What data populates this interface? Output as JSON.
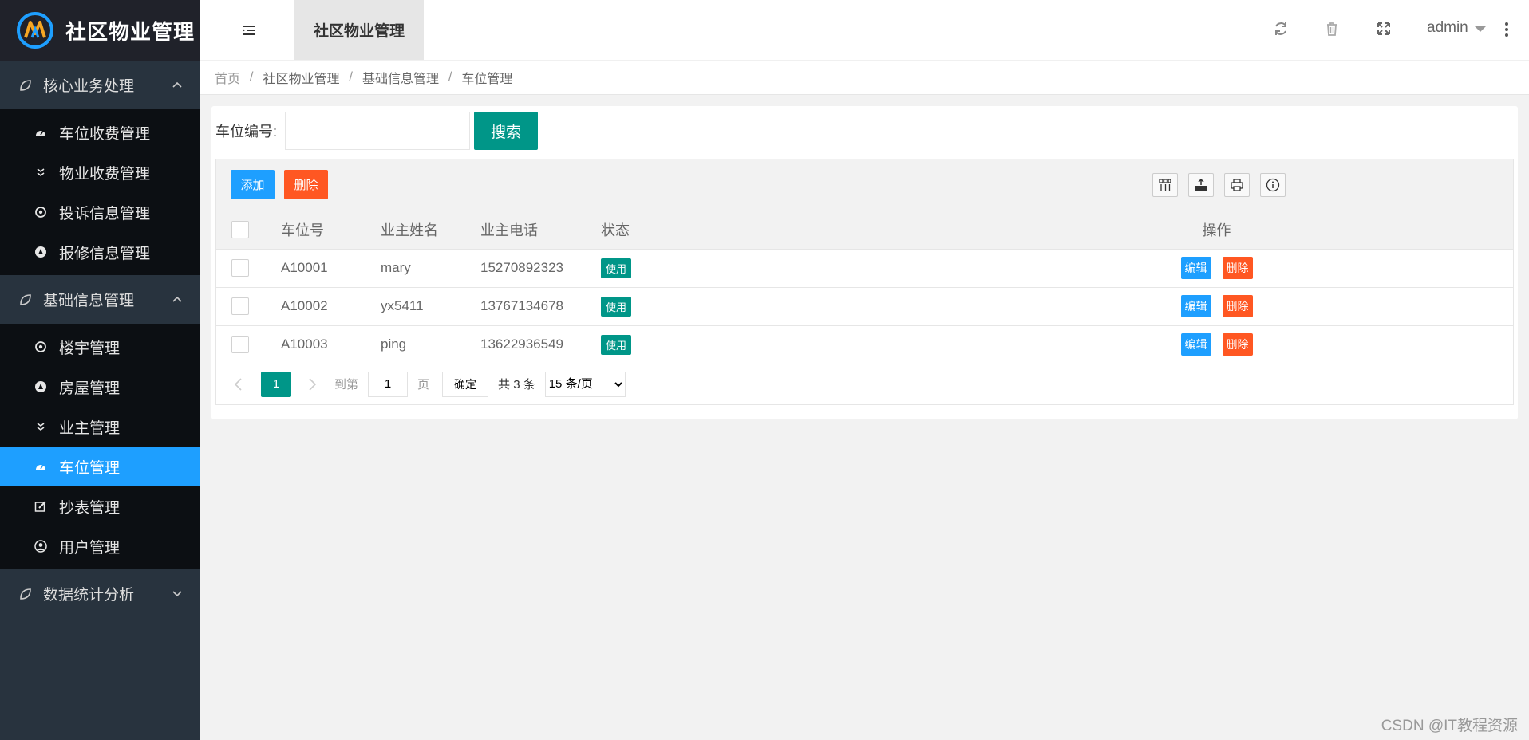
{
  "app": {
    "title": "社区物业管理"
  },
  "sidebar": {
    "groups": [
      {
        "label": "核心业务处理",
        "expanded": true,
        "items": [
          {
            "label": "车位收费管理",
            "icon": "dashboard-icon"
          },
          {
            "label": "物业收费管理",
            "icon": "double-chevron-icon"
          },
          {
            "label": "投诉信息管理",
            "icon": "circle-dot-icon"
          },
          {
            "label": "报修信息管理",
            "icon": "compass-icon"
          }
        ]
      },
      {
        "label": "基础信息管理",
        "expanded": true,
        "items": [
          {
            "label": "楼宇管理",
            "icon": "circle-dot-icon"
          },
          {
            "label": "房屋管理",
            "icon": "compass-icon"
          },
          {
            "label": "业主管理",
            "icon": "double-chevron-icon"
          },
          {
            "label": "车位管理",
            "icon": "dashboard-icon",
            "active": true
          },
          {
            "label": "抄表管理",
            "icon": "edit-icon"
          },
          {
            "label": "用户管理",
            "icon": "user-icon"
          }
        ]
      },
      {
        "label": "数据统计分析",
        "expanded": false,
        "items": []
      }
    ]
  },
  "header": {
    "tab": "社区物业管理",
    "user": "admin"
  },
  "breadcrumb": [
    "首页",
    "社区物业管理",
    "基础信息管理",
    "车位管理"
  ],
  "search": {
    "label": "车位编号:",
    "value": "",
    "button": "搜索"
  },
  "toolbar": {
    "add": "添加",
    "delete": "删除"
  },
  "table": {
    "headers": [
      "车位号",
      "业主姓名",
      "业主电话",
      "状态",
      "操作"
    ],
    "rows": [
      {
        "no": "A10001",
        "owner": "mary",
        "phone": "15270892323",
        "state": "使用"
      },
      {
        "no": "A10002",
        "owner": "yx5411",
        "phone": "13767134678",
        "state": "使用"
      },
      {
        "no": "A10003",
        "owner": "ping",
        "phone": "13622936549",
        "state": "使用"
      }
    ],
    "op_edit": "编辑",
    "op_delete": "删除"
  },
  "pager": {
    "current": "1",
    "goto_prefix": "到第",
    "goto_value": "1",
    "goto_suffix": "页",
    "confirm": "确定",
    "total": "共 3 条",
    "page_size": "15 条/页"
  },
  "watermark": "CSDN @IT教程资源",
  "colors": {
    "sidebar": "#28333e",
    "active": "#1e9fff",
    "primary": "#009688",
    "danger": "#ff5722"
  }
}
